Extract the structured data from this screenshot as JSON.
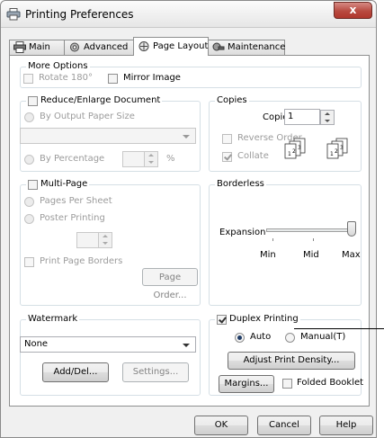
{
  "window": {
    "title": "Printing Preferences",
    "close_label": "x"
  },
  "tabs": [
    {
      "label": "Main",
      "icon": "printer-icon"
    },
    {
      "label": "Advanced",
      "icon": "gear-icon"
    },
    {
      "label": "Page Layout",
      "icon": "page-layout-icon"
    },
    {
      "label": "Maintenance",
      "icon": "maintenance-icon"
    }
  ],
  "more_options": {
    "label": "More Options",
    "rotate_label": "Rotate 180°",
    "rotate_checked": false,
    "mirror_label": "Mirror Image",
    "mirror_checked": false
  },
  "reduce_enlarge": {
    "label": "Reduce/Enlarge Document",
    "checked": false,
    "by_output_label": "By Output Paper Size",
    "paper_size_value": "",
    "by_percentage_label": "By Percentage",
    "percentage_value": "",
    "percent_sign": "%"
  },
  "copies": {
    "label": "Copies",
    "copies_label": "Copies",
    "copies_value": "1",
    "reverse_label": "Reverse Order",
    "reverse_checked": false,
    "collate_label": "Collate",
    "collate_checked": true
  },
  "multi_page": {
    "label": "Multi-Page",
    "checked": false,
    "pages_per_sheet_label": "Pages Per Sheet",
    "poster_label": "Poster Printing",
    "pages_value": "",
    "borders_label": "Print Page Borders",
    "borders_checked": false,
    "page_order_label": "Page Order..."
  },
  "borderless": {
    "label": "Borderless",
    "expansion_label": "Expansion",
    "expansion_level": 1.0,
    "min_label": "Min",
    "mid_label": "Mid",
    "max_label": "Max"
  },
  "watermark": {
    "label": "Watermark",
    "selected": "None",
    "add_del_label": "Add/Del...",
    "settings_label": "Settings..."
  },
  "duplex": {
    "label": "Duplex Printing",
    "checked": true,
    "auto_label": "Auto",
    "auto_selected": true,
    "manual_label": "Manual(T)",
    "adjust_label": "Adjust Print Density...",
    "margins_label": "Margins...",
    "folded_label": "Folded Booklet",
    "folded_checked": false
  },
  "footer": {
    "ok_label": "OK",
    "cancel_label": "Cancel",
    "help_label": "Help"
  },
  "colors": {
    "close_red": "#c1463c",
    "selected_blue": "#1f3c66",
    "group_border": "#d5dfe5"
  }
}
